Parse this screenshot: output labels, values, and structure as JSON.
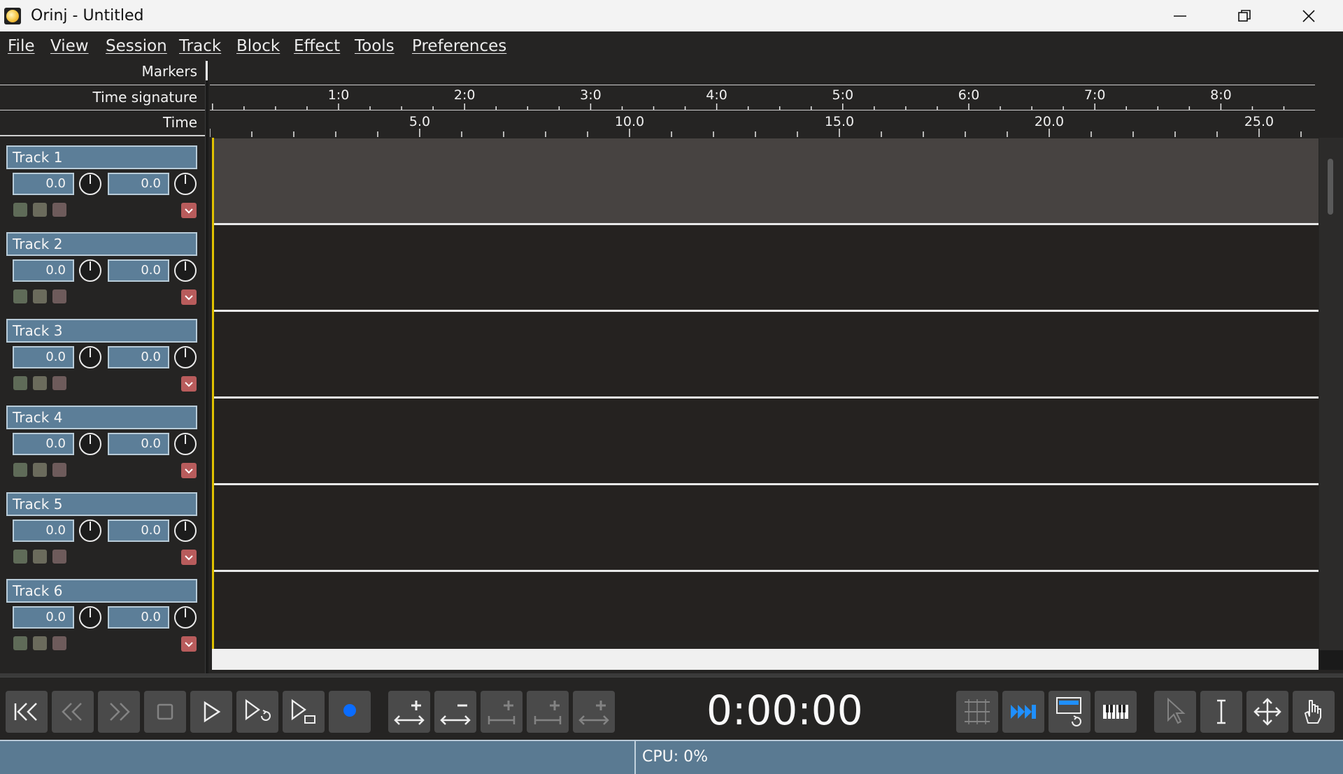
{
  "window": {
    "title": "Orinj - Untitled",
    "icon": "orinj-sun-icon"
  },
  "menu": [
    "File",
    "View",
    "Session",
    "Track",
    "Block",
    "Effect",
    "Tools",
    "Preferences"
  ],
  "rulers": {
    "markers_label": "Markers",
    "time_signature_label": "Time signature",
    "time_label": "Time",
    "time_signature_ticks": [
      "1:0",
      "2:0",
      "3:0",
      "4:0",
      "5:0",
      "6:0",
      "7:0",
      "8:0"
    ],
    "time_ticks": [
      "5.0",
      "10.0",
      "15.0",
      "20.0",
      "25.0"
    ]
  },
  "tracks": [
    {
      "name": "Track 1",
      "volume": "0.0",
      "pan": "0.0",
      "selected": true
    },
    {
      "name": "Track 2",
      "volume": "0.0",
      "pan": "0.0",
      "selected": false
    },
    {
      "name": "Track 3",
      "volume": "0.0",
      "pan": "0.0",
      "selected": false
    },
    {
      "name": "Track 4",
      "volume": "0.0",
      "pan": "0.0",
      "selected": false
    },
    {
      "name": "Track 5",
      "volume": "0.0",
      "pan": "0.0",
      "selected": false
    },
    {
      "name": "Track 6",
      "volume": "0.0",
      "pan": "0.0",
      "selected": false
    }
  ],
  "transport": {
    "time": "0:00:00",
    "buttons": [
      "go-to-start-icon",
      "rewind-icon",
      "fast-forward-icon",
      "stop-icon",
      "play-icon",
      "play-loop-icon",
      "play-selection-icon",
      "record-icon"
    ],
    "zoom_buttons": [
      "zoom-in-horizontal-icon",
      "zoom-out-horizontal-icon",
      "zoom-to-selection-icon",
      "zoom-fit-icon",
      "zoom-all-icon"
    ],
    "tool_buttons": [
      "snap-grid-icon",
      "follow-playhead-icon",
      "loop-view-icon",
      "piano-icon",
      "pointer-tool-icon",
      "text-cursor-tool-icon",
      "move-tool-icon",
      "hand-tool-icon"
    ]
  },
  "status": {
    "cpu": "CPU: 0%"
  },
  "colors": {
    "accent": "#5c7e98",
    "record": "#0a6cff",
    "playhead": "#e0c200",
    "mute_dropdown": "#b85c5c"
  }
}
